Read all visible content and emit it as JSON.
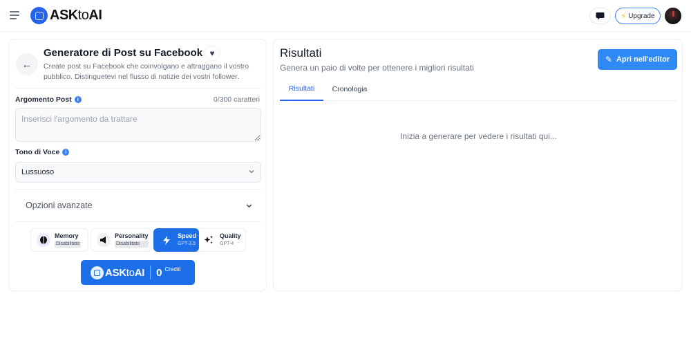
{
  "header": {
    "brand_prefix": "ASK",
    "brand_mid": "to",
    "brand_suffix": "AI",
    "upgrade_label": "Upgrade",
    "icons": {
      "menu": "hamburger-icon",
      "chat": "chat-bubble-icon",
      "upgrade": "lightning-icon"
    }
  },
  "tool": {
    "title": "Generatore di Post su Facebook",
    "description": "Create post su Facebook che coinvolgano e attraggano il vostro pubblico. Distinguetevi nel flusso di notizie dei vostri follower.",
    "fields": {
      "topic_label": "Argomento Post",
      "topic_count": "0/300 caratteri",
      "topic_placeholder": "Inserisci l'argomento da trattare",
      "topic_value": "",
      "tone_label": "Tono di Voce",
      "tone_value": "Lussuoso"
    },
    "advanced_label": "Opzioni avanzate",
    "modes": [
      {
        "name": "Memory",
        "status": "Disabilitato",
        "icon": "brain-icon"
      },
      {
        "name": "Personality",
        "status": "Disabilitato",
        "icon": "megaphone-icon"
      },
      {
        "name": "Speed",
        "status": "GPT-3.5",
        "icon": "lightning-icon",
        "active": true
      },
      {
        "name": "Quality",
        "status": "GPT-4",
        "icon": "sparkles-icon"
      }
    ],
    "generate": {
      "brand_prefix": "ASK",
      "brand_mid": "to",
      "brand_suffix": "AI",
      "credits": "0",
      "credits_label": "Crediti"
    }
  },
  "results": {
    "title": "Risultati",
    "subtitle": "Genera un paio di volte per ottenere i migliori risultati",
    "editor_button": "Apri nell'editor",
    "tabs": [
      {
        "label": "Risultati",
        "active": true
      },
      {
        "label": "Cronologia",
        "active": false
      }
    ],
    "empty_message": "Inizia a generare per vedere i risultati qui..."
  },
  "colors": {
    "primary": "#1d6fe8",
    "editor_button": "#2f8af5",
    "tab_active": "#2563eb",
    "upgrade_bolt": "#f5b301"
  }
}
